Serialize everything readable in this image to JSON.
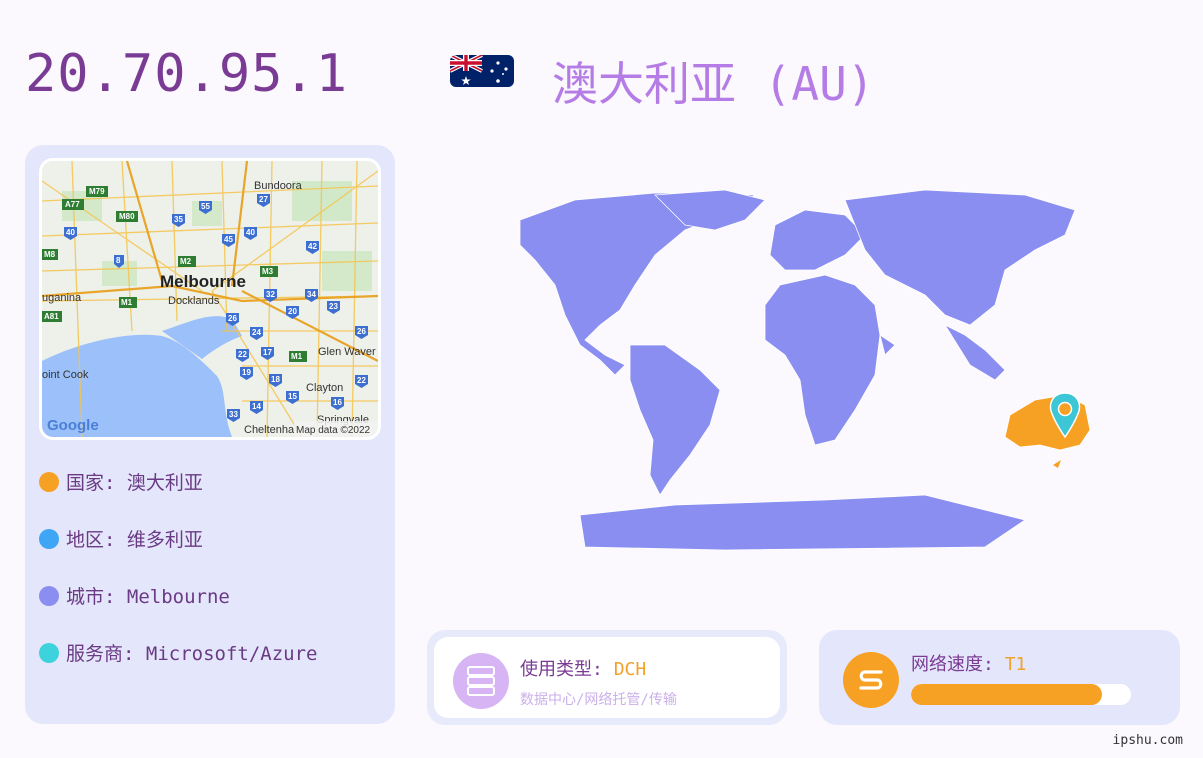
{
  "ip": "20.70.95.1",
  "country_title": "澳大利亚 (AU)",
  "map": {
    "city_label": "Melbourne",
    "places": [
      "Bundoora",
      "Docklands",
      "Glen Waver",
      "oint Cook",
      "Clayton",
      "Springvale",
      "Cheltenha",
      "uganina"
    ],
    "road_labels": [
      "M79",
      "A77",
      "M80",
      "M8",
      "A81",
      "M1",
      "M2",
      "M3",
      "M1"
    ],
    "route_numbers": [
      "55",
      "27",
      "35",
      "40",
      "45",
      "40",
      "42",
      "8",
      "32",
      "34",
      "23",
      "26",
      "20",
      "24",
      "26",
      "22",
      "17",
      "19",
      "18",
      "15",
      "16",
      "14",
      "33",
      "22"
    ],
    "google_label": "Google",
    "attribution": "Map data ©2022"
  },
  "info": [
    {
      "label": "国家: 澳大利亚",
      "color": "#f7a124"
    },
    {
      "label": "地区: 维多利亚",
      "color": "#3ea6f5"
    },
    {
      "label": "城市: Melbourne",
      "color": "#8a8ef0"
    },
    {
      "label": "服务商: Microsoft/Azure",
      "color": "#3dd3dd"
    }
  ],
  "usage": {
    "title": "使用类型: ",
    "value": "DCH",
    "subtitle": "数据中心/网络托管/传输"
  },
  "speed": {
    "title": "网络速度: ",
    "value": "T1",
    "level_fraction": 0.87
  },
  "watermark": "ipshu.com",
  "colors": {
    "land": "#8a8ef0",
    "highlight": "#f7a124",
    "pin": "#3dc6d6"
  }
}
